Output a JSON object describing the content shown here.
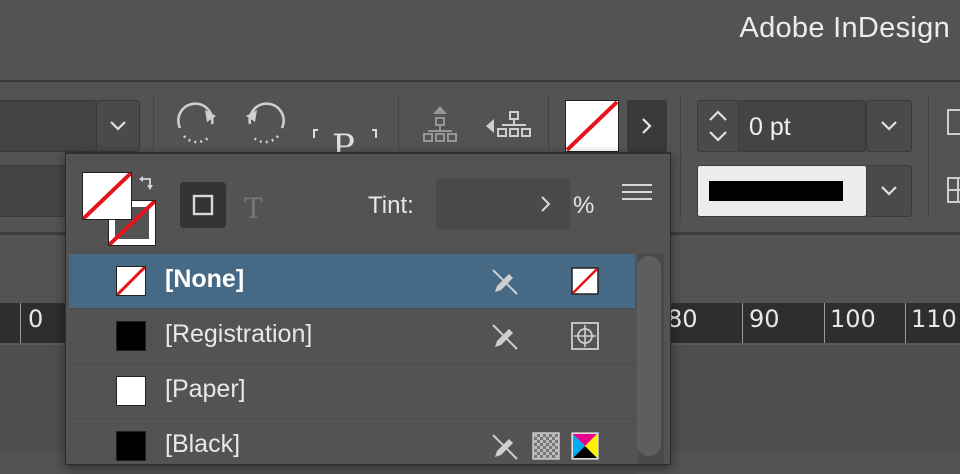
{
  "app": {
    "title": "Adobe InDesign"
  },
  "control_bar": {
    "stroke_weight": {
      "value": "0 pt"
    },
    "stroke_type_swatch_color": "#000000"
  },
  "swatch_panel": {
    "tint_label": "Tint:",
    "tint_value": "",
    "percent_label": "%",
    "swatches": [
      {
        "name": "[None]",
        "chip": "none",
        "selected": true,
        "icons": [
          "pencil-slash-icon",
          "none-mode-icon"
        ]
      },
      {
        "name": "[Registration]",
        "chip": "#000000",
        "selected": false,
        "icons": [
          "pencil-slash-icon",
          "registration-mode-icon"
        ]
      },
      {
        "name": "[Paper]",
        "chip": "#ffffff",
        "selected": false,
        "icons": []
      },
      {
        "name": "[Black]",
        "chip": "#000000",
        "selected": false,
        "icons": [
          "pencil-slash-icon",
          "process-icon",
          "cmyk-icon"
        ]
      }
    ]
  },
  "ruler": {
    "labels": [
      "0",
      "80",
      "90",
      "100",
      "110"
    ]
  },
  "colors": {
    "ui_background": "#535353",
    "selection": "#466a86",
    "none_slash": "#e4141b"
  }
}
